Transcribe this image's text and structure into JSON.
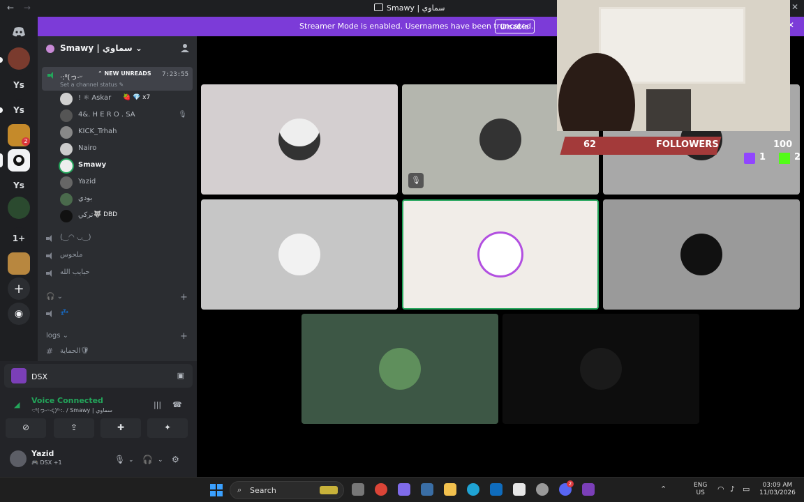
{
  "window": {
    "title": "Smawy | سماوي",
    "back": "←",
    "forward": "→",
    "close": "✕"
  },
  "banner": {
    "message": "Streamer Mode is enabled. Usernames have been truncated.",
    "disable_label": "Disable",
    "close": "✕"
  },
  "guilds": [
    "Ys",
    "Ys",
    "Ys",
    "1+"
  ],
  "guild_badge": "2",
  "server": {
    "name": "Smawy | سماوي ⌄",
    "add_member_icon": "add-member-icon"
  },
  "active_channel": {
    "name": "·:⁰(っ-ᵕ",
    "unread_label": "⌃ NEW UNREADS",
    "timer": "7:23:55",
    "status": "Set a channel status ✎"
  },
  "members": [
    {
      "name": "! ⚛ Askar",
      "extra": "🍓 💎 x7"
    },
    {
      "name": "4&. H E R O . SA",
      "extra": ""
    },
    {
      "name": "KICK_Trhah",
      "extra": ""
    },
    {
      "name": "Nairo",
      "extra": ""
    },
    {
      "name": "Smawy",
      "extra": ""
    },
    {
      "name": "Yazid",
      "extra": ""
    },
    {
      "name": "بودي",
      "extra": ""
    },
    {
      "name": "تركي",
      "extra": "🐺 DBD"
    }
  ],
  "channels": [
    {
      "name": "(‿◠ ◡‿)"
    },
    {
      "name": "ملحوس"
    },
    {
      "name": "حبايب الله"
    }
  ],
  "category_1": {
    "label": "🎧 ⌄",
    "plus": "+"
  },
  "channel_music": {
    "name": "💤"
  },
  "category_logs": {
    "label": "logs ⌄",
    "plus": "+"
  },
  "channel_logs": {
    "name": "الحماية🛡"
  },
  "panel": {
    "stream_name": "DSX",
    "voice_status": "Voice Connected",
    "voice_sub": "·:⁰(っ-ᵕ-ς)⁰·:. / Smawy | سماوي",
    "user_name": "Yazid",
    "user_tag": "🎮 DSX +1"
  },
  "overlay": {
    "count_left": "62",
    "label": "FOLLOWERS",
    "count_right": "100",
    "twitch": "1",
    "kick": "2"
  },
  "taskbar": {
    "search_label": "Search",
    "lang_top": "ENG",
    "lang_bottom": "US",
    "time": "03:09 AM",
    "date": "11/03/2026",
    "discord_badge": "2"
  },
  "colors": {
    "banner": "#7c3bd8",
    "voice_connected": "#23a55a",
    "speaking_border": "#23a55a"
  }
}
